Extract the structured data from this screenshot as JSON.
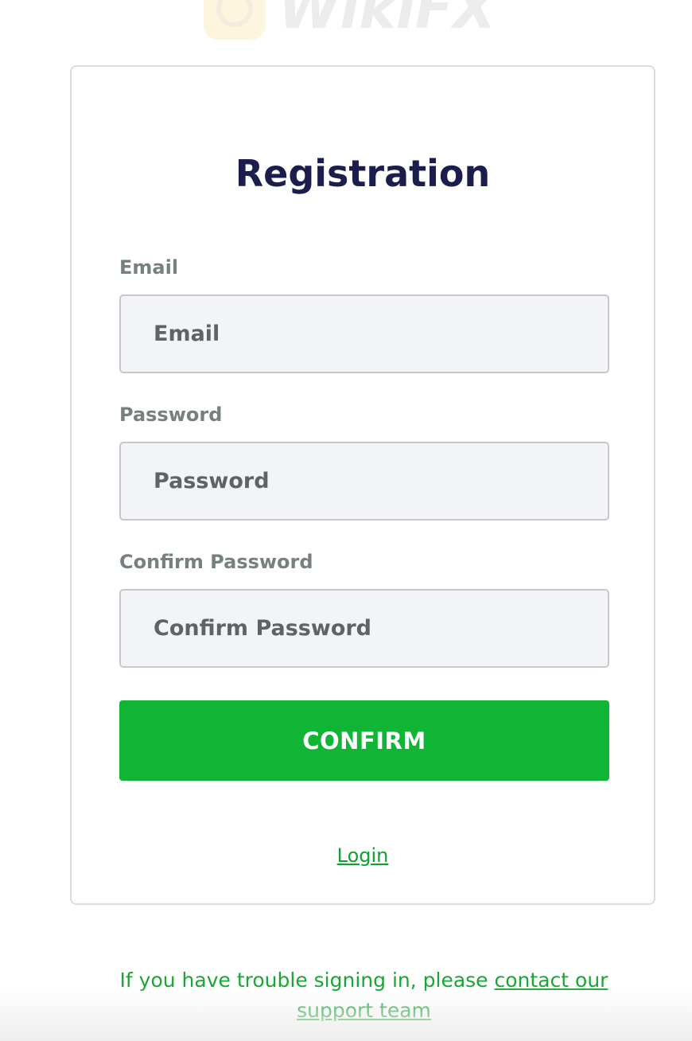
{
  "form": {
    "title": "Registration",
    "email": {
      "label": "Email",
      "placeholder": "Email"
    },
    "password": {
      "label": "Password",
      "placeholder": "Password"
    },
    "confirm_password": {
      "label": "Confirm Password",
      "placeholder": "Confirm Password"
    },
    "confirm_button_label": "CONFIRM",
    "login_link_label": "Login"
  },
  "footer": {
    "support_text": "If you have trouble signing in, please",
    "support_link_label": "contact our support team"
  },
  "watermark": {
    "text": "WikiFX"
  },
  "colors": {
    "title": "#1b1d4d",
    "accent_green": "#10b535",
    "link_green": "#1aa535",
    "input_background": "#f3f4f8"
  }
}
